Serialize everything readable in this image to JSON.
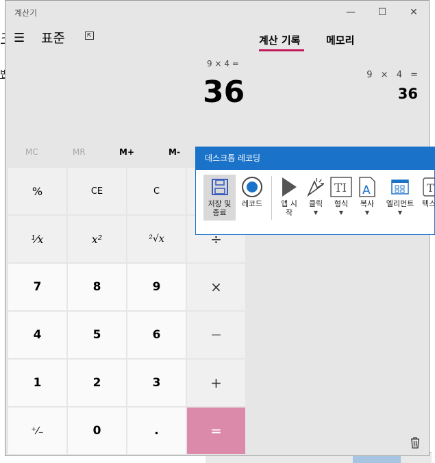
{
  "background": {
    "text1": "크",
    "text2": "번"
  },
  "window": {
    "title": "계산기",
    "controls": {
      "minimize": "—",
      "maximize": "☐",
      "close": "✕"
    }
  },
  "header": {
    "menu_icon": "☰",
    "mode": "표준",
    "keep_on_top_icon": "keep-on-top-icon"
  },
  "tabs": [
    {
      "label": "계산 기록",
      "active": true
    },
    {
      "label": "메모리",
      "active": false
    }
  ],
  "display": {
    "expression": "9 × 4 =",
    "value": "36"
  },
  "history": {
    "expression": "9 × 4 =",
    "value": "36"
  },
  "memory_buttons": [
    "MC",
    "MR",
    "M+",
    "M-"
  ],
  "keypad": {
    "percent": "%",
    "ce": "CE",
    "c": "C",
    "reciprocal": "¹⁄x",
    "square": "x²",
    "sqrt": "²√x",
    "divide": "÷",
    "seven": "7",
    "eight": "8",
    "nine": "9",
    "multiply": "×",
    "four": "4",
    "five": "5",
    "six": "6",
    "minus": "—",
    "one": "1",
    "two": "2",
    "three": "3",
    "plus": "+",
    "negate": "⁺⁄₋",
    "zero": "0",
    "decimal": ".",
    "equals": "="
  },
  "recorder": {
    "title": "데스크톱 레코딩",
    "tools": {
      "save": "저장 및 종료",
      "record": "레코드",
      "app_start": "앱 시작",
      "click": "클릭",
      "format": "형식",
      "copy": "복사",
      "element": "엘리먼트",
      "text": "텍스"
    }
  },
  "colors": {
    "accent": "#c3185b",
    "equals_key": "#db8aa9",
    "recorder_blue": "#1a73c8"
  }
}
